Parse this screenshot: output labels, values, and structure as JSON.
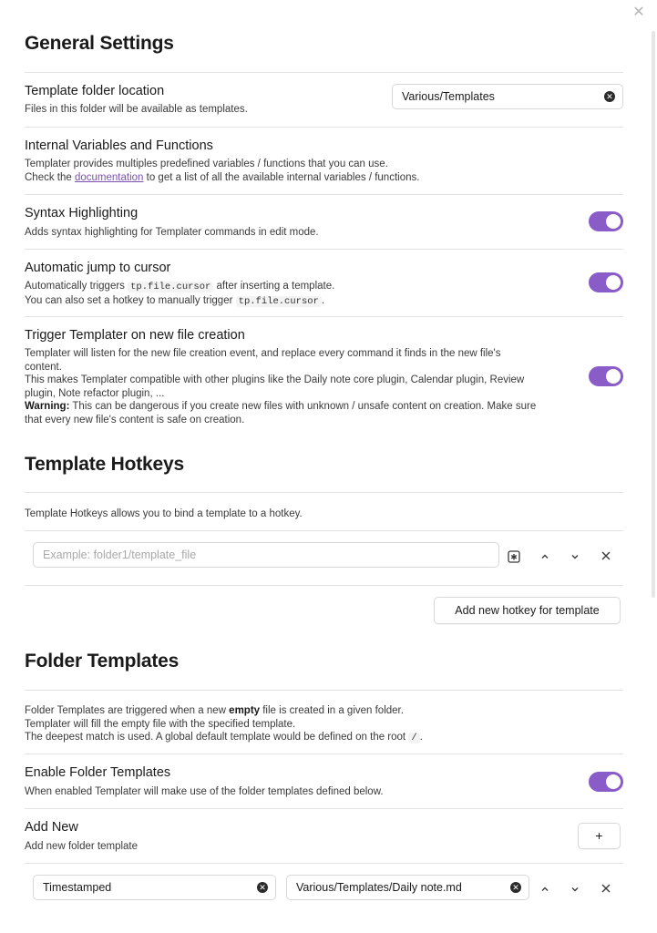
{
  "modal": {
    "close_icon": "close-icon"
  },
  "general": {
    "title": "General Settings",
    "template_folder": {
      "name": "Template folder location",
      "desc": "Files in this folder will be available as templates.",
      "value": "Various/Templates"
    },
    "internal_vars": {
      "name": "Internal Variables and Functions",
      "desc_line1": "Templater provides multiples predefined variables / functions that you can use.",
      "desc_line2_prefix": "Check the ",
      "desc_link": "documentation",
      "desc_line2_suffix": " to get a list of all the available internal variables / functions."
    },
    "syntax": {
      "name": "Syntax Highlighting",
      "desc": "Adds syntax highlighting for Templater commands in edit mode.",
      "enabled": true
    },
    "jump_cursor": {
      "name": "Automatic jump to cursor",
      "desc_a1": "Automatically triggers ",
      "code1": "tp.file.cursor",
      "desc_a2": " after inserting a template.",
      "desc_b1": "You can also set a hotkey to manually trigger ",
      "code2": "tp.file.cursor",
      "desc_b2": ".",
      "enabled": true
    },
    "trigger_new_file": {
      "name": "Trigger Templater on new file creation",
      "desc_line1": "Templater will listen for the new file creation event, and replace every command it finds in the new file's",
      "desc_line2": "content.",
      "desc_line3": "This makes Templater compatible with other plugins like the Daily note core plugin, Calendar plugin, Review",
      "desc_line4": "plugin, Note refactor plugin, ...",
      "warning_label": "Warning:",
      "warning_line1": " This can be dangerous if you create new files with unknown / unsafe content on creation. Make sure",
      "warning_line2": "that every new file's content is safe on creation.",
      "enabled": true
    }
  },
  "hotkeys": {
    "title": "Template Hotkeys",
    "desc": "Template Hotkeys allows you to bind a template to a hotkey.",
    "input_placeholder": "Example: folder1/template_file",
    "add_button": "Add new hotkey for template"
  },
  "folder_templates": {
    "title": "Folder Templates",
    "desc_a1": "Folder Templates are triggered when a new ",
    "desc_a_bold": "empty",
    "desc_a2": " file is created in a given folder.",
    "desc_b": "Templater will fill the empty file with the specified template.",
    "desc_c1": "The deepest match is used. A global default template would be defined on the root ",
    "desc_c_code": "/",
    "desc_c2": ".",
    "enable": {
      "name": "Enable Folder Templates",
      "desc": "When enabled Templater will make use of the folder templates defined below.",
      "enabled": true
    },
    "add_new": {
      "name": "Add New",
      "desc": "Add new folder template",
      "button": "+"
    },
    "entry": {
      "folder": "Timestamped",
      "template": "Various/Templates/Daily note.md"
    }
  },
  "colors": {
    "accent": "#8a5cc7",
    "link": "#7d4fb3"
  }
}
